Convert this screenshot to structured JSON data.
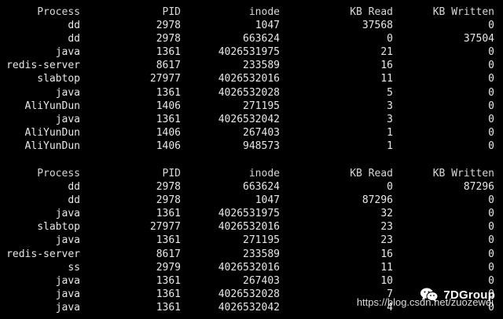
{
  "headers": {
    "process": "Process",
    "pid": "PID",
    "inode": "inode",
    "kb_read": "KB Read",
    "kb_written": "KB Written"
  },
  "tables": [
    {
      "rows": [
        {
          "process": "dd",
          "pid": "2978",
          "inode": "1047",
          "kb_read": "37568",
          "kb_written": "0"
        },
        {
          "process": "dd",
          "pid": "2978",
          "inode": "663624",
          "kb_read": "0",
          "kb_written": "37504"
        },
        {
          "process": "java",
          "pid": "1361",
          "inode": "4026531975",
          "kb_read": "21",
          "kb_written": "0"
        },
        {
          "process": "redis-server",
          "pid": "8617",
          "inode": "233589",
          "kb_read": "16",
          "kb_written": "0"
        },
        {
          "process": "slabtop",
          "pid": "27977",
          "inode": "4026532016",
          "kb_read": "11",
          "kb_written": "0"
        },
        {
          "process": "java",
          "pid": "1361",
          "inode": "4026532028",
          "kb_read": "5",
          "kb_written": "0"
        },
        {
          "process": "AliYunDun",
          "pid": "1406",
          "inode": "271195",
          "kb_read": "3",
          "kb_written": "0"
        },
        {
          "process": "java",
          "pid": "1361",
          "inode": "4026532042",
          "kb_read": "3",
          "kb_written": "0"
        },
        {
          "process": "AliYunDun",
          "pid": "1406",
          "inode": "267403",
          "kb_read": "1",
          "kb_written": "0"
        },
        {
          "process": "AliYunDun",
          "pid": "1406",
          "inode": "948573",
          "kb_read": "1",
          "kb_written": "0"
        }
      ]
    },
    {
      "rows": [
        {
          "process": "dd",
          "pid": "2978",
          "inode": "663624",
          "kb_read": "0",
          "kb_written": "87296"
        },
        {
          "process": "dd",
          "pid": "2978",
          "inode": "1047",
          "kb_read": "87296",
          "kb_written": "0"
        },
        {
          "process": "java",
          "pid": "1361",
          "inode": "4026531975",
          "kb_read": "32",
          "kb_written": "0"
        },
        {
          "process": "slabtop",
          "pid": "27977",
          "inode": "4026532016",
          "kb_read": "23",
          "kb_written": "0"
        },
        {
          "process": "java",
          "pid": "1361",
          "inode": "271195",
          "kb_read": "23",
          "kb_written": "0"
        },
        {
          "process": "redis-server",
          "pid": "8617",
          "inode": "233589",
          "kb_read": "16",
          "kb_written": "0"
        },
        {
          "process": "ss",
          "pid": "2979",
          "inode": "4026532016",
          "kb_read": "11",
          "kb_written": "0"
        },
        {
          "process": "java",
          "pid": "1361",
          "inode": "267403",
          "kb_read": "10",
          "kb_written": "0"
        },
        {
          "process": "java",
          "pid": "1361",
          "inode": "4026532028",
          "kb_read": "7",
          "kb_written": "0"
        },
        {
          "process": "java",
          "pid": "1361",
          "inode": "4026532042",
          "kb_read": "4",
          "kb_written": "0"
        }
      ]
    }
  ],
  "watermark": {
    "brand": "7DGroup",
    "url": "https://blog.csdn.net/zuozewei",
    "icon": "wechat-icon"
  },
  "colors": {
    "background": "#000000",
    "text": "#e8e8e8"
  }
}
